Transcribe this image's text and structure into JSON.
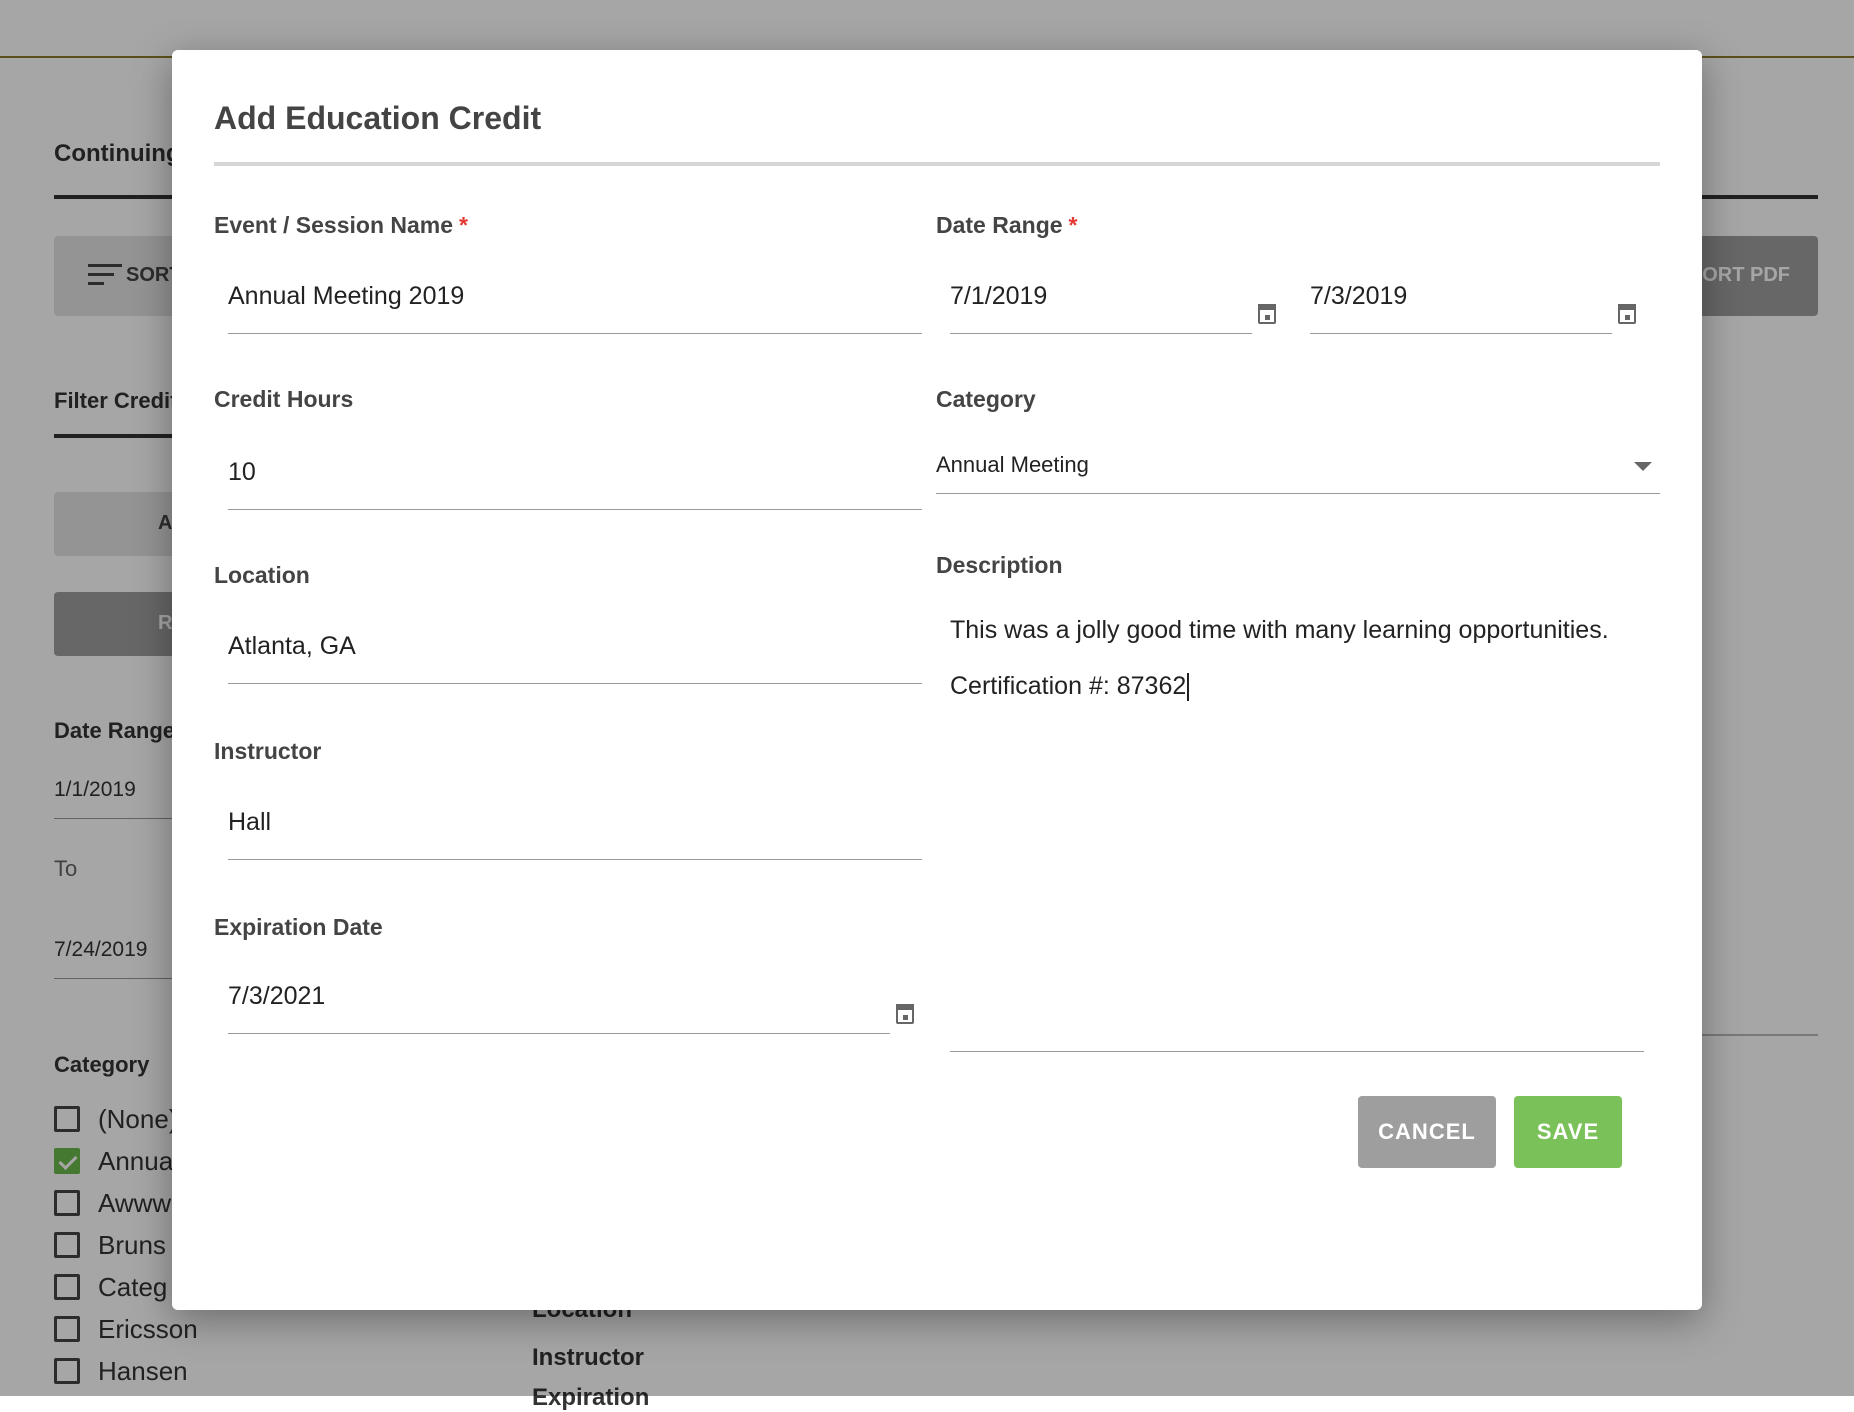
{
  "background": {
    "title": "Continuing",
    "sort_label": "SORT",
    "pdf_label": "ORT PDF",
    "filter_title": "Filter Credit",
    "btn_a_label": "A",
    "btn_r_label": "R",
    "date_range_label": "Date Range",
    "from_value": "1/1/2019",
    "to_label": "To",
    "to_value": "7/24/2019",
    "category_label": "Category",
    "categories": [
      {
        "label": "(None)",
        "checked": false
      },
      {
        "label": "Annua",
        "checked": true
      },
      {
        "label": "Awww",
        "checked": false
      },
      {
        "label": "Bruns",
        "checked": false
      },
      {
        "label": "Categ",
        "checked": false
      },
      {
        "label": "Ericsson",
        "checked": false
      },
      {
        "label": "Hansen",
        "checked": false
      }
    ],
    "detail_location": "Location",
    "detail_instructor": "Instructor",
    "detail_expiration": "Expiration"
  },
  "modal": {
    "title": "Add Education Credit",
    "event_label": "Event / Session Name",
    "event_value": "Annual Meeting 2019",
    "date_range_label": "Date Range",
    "date_start": "7/1/2019",
    "date_end": "7/3/2019",
    "credit_hours_label": "Credit Hours",
    "credit_hours_value": "10",
    "category_label": "Category",
    "category_value": "Annual Meeting",
    "location_label": "Location",
    "location_value": "Atlanta, GA",
    "description_label": "Description",
    "description_line1": "This was a jolly good time with many learning opportunities.",
    "description_line2": "Certification #: 87362",
    "instructor_label": "Instructor",
    "instructor_value": "Hall",
    "expiration_label": "Expiration Date",
    "expiration_value": "7/3/2021",
    "required_mark": "*",
    "cancel_label": "CANCEL",
    "save_label": "SAVE"
  },
  "colors": {
    "save": "#7bc159",
    "cancel": "#9e9e9e",
    "required": "#e53935",
    "checkbox_checked": "#6bb84a"
  }
}
